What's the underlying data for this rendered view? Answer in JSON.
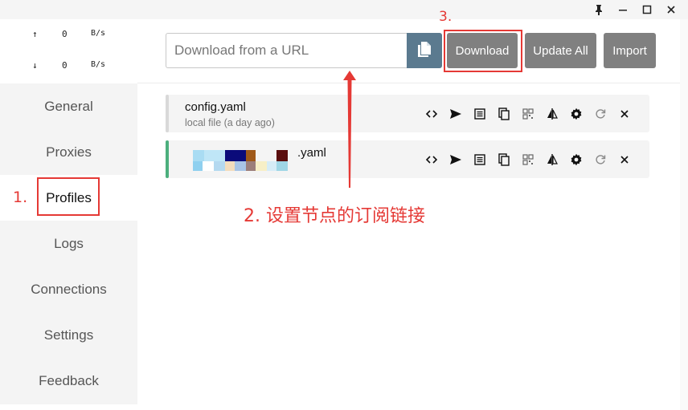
{
  "window": {
    "pin_icon": "pin-icon",
    "minimize_icon": "minimize-icon",
    "maximize_icon": "maximize-icon",
    "close_icon": "close-icon"
  },
  "traffic": {
    "upload": {
      "arrow": "↑",
      "value": "0",
      "unit": "B/s"
    },
    "download": {
      "arrow": "↓",
      "value": "0",
      "unit": "B/s"
    }
  },
  "sidebar": {
    "items": [
      {
        "label": "General"
      },
      {
        "label": "Proxies"
      },
      {
        "label": "Profiles",
        "active": true
      },
      {
        "label": "Logs"
      },
      {
        "label": "Connections"
      },
      {
        "label": "Settings"
      },
      {
        "label": "Feedback"
      }
    ]
  },
  "toolbar": {
    "url_placeholder": "Download from a URL",
    "url_value": "",
    "download_label": "Download",
    "update_all_label": "Update All",
    "import_label": "Import"
  },
  "profiles": [
    {
      "name": "config.yaml",
      "subtitle": "local file (a day ago)",
      "bar_color": "#d9d9d9"
    },
    {
      "name": ".yaml",
      "subtitle": "",
      "bar_color": "#4caf7d"
    }
  ],
  "profile_actions": [
    "code-icon",
    "send-icon",
    "list-icon",
    "copy-icon",
    "qrcode-icon",
    "split-icon",
    "gear-icon",
    "refresh-icon",
    "close-icon"
  ],
  "annotations": {
    "step1": "1.",
    "step2": "2. 设置节点的订阅链接",
    "step3": "3."
  },
  "colors": {
    "annotation_red": "#e53935",
    "paste_button": "#5b7a8f",
    "action_button": "#808080",
    "active_bar": "#4caf7d"
  }
}
